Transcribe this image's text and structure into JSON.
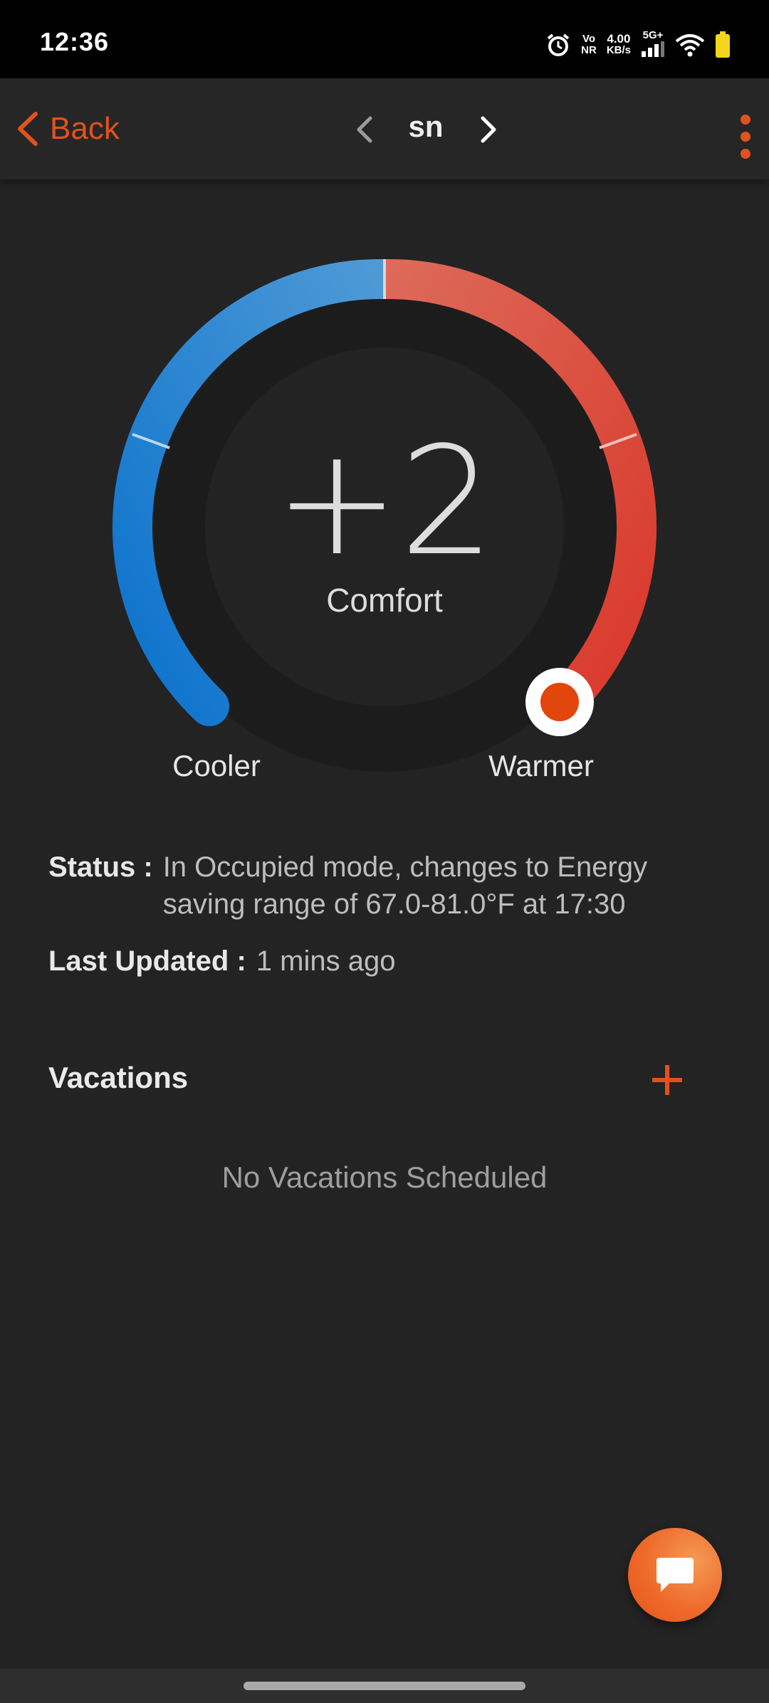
{
  "status_bar": {
    "time": "12:36",
    "network_top": "Vo",
    "network_bottom": "NR",
    "speed_top": "4.00",
    "speed_bottom": "KB/s",
    "signal_label": "5G+",
    "icons": [
      "alarm-icon",
      "signal-icon",
      "wifi-icon",
      "battery-icon"
    ]
  },
  "header": {
    "back_label": "Back",
    "title": "sn",
    "accent_color": "#e2521c"
  },
  "dial": {
    "value": "+2",
    "mode": "Comfort",
    "cooler_label": "Cooler",
    "warmer_label": "Warmer",
    "cool_color": "#1976cf",
    "warm_color": "#e0442a"
  },
  "status": {
    "label": "Status :",
    "text": "In Occupied mode, changes to Energy saving range of 67.0-81.0°F at 17:30"
  },
  "last_updated": {
    "label": "Last Updated :",
    "value": "1 mins ago"
  },
  "vacations": {
    "title": "Vacations",
    "empty_text": "No Vacations Scheduled"
  },
  "fab": {
    "icon": "chat-icon"
  }
}
